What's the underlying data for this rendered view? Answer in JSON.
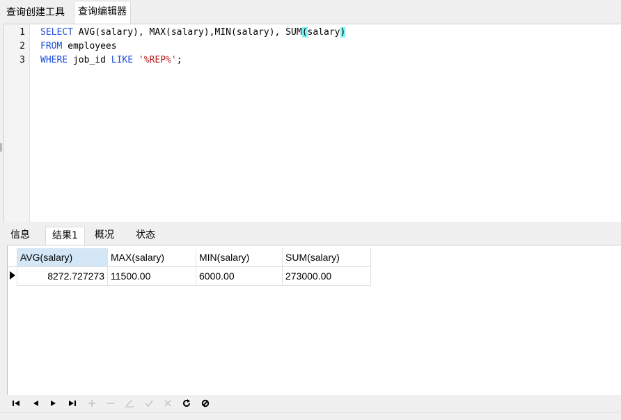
{
  "top_tabs": [
    {
      "label": "查询创建工具"
    },
    {
      "label": "查询编辑器"
    }
  ],
  "editor": {
    "line_numbers": [
      "1",
      "2",
      "3"
    ],
    "lines": [
      {
        "parts": [
          {
            "t": "SELECT",
            "k": "kw"
          },
          {
            "t": " AVG(salary), MAX(salary),MIN(salary), SUM"
          },
          {
            "t": "(",
            "k": "bracket"
          },
          {
            "t": "salary"
          },
          {
            "t": ")",
            "k": "bracket"
          }
        ]
      },
      {
        "parts": [
          {
            "t": "FROM",
            "k": "kw"
          },
          {
            "t": " employees"
          }
        ]
      },
      {
        "parts": [
          {
            "t": "WHERE",
            "k": "kw"
          },
          {
            "t": " job_id "
          },
          {
            "t": "LIKE",
            "k": "kw"
          },
          {
            "t": " "
          },
          {
            "t": "'%REP%'",
            "k": "str"
          },
          {
            "t": ";"
          }
        ]
      }
    ]
  },
  "bottom_tabs": [
    {
      "label": "信息"
    },
    {
      "label": "结果1"
    },
    {
      "label": "概况"
    },
    {
      "label": "状态"
    }
  ],
  "result_grid": {
    "columns": [
      "AVG(salary)",
      "MAX(salary)",
      "MIN(salary)",
      "SUM(salary)"
    ],
    "rows": [
      [
        "8272.727273",
        "11500.00",
        "6000.00",
        "273000.00"
      ]
    ]
  },
  "nav_icons": [
    "first-record-icon",
    "prev-record-icon",
    "next-record-icon",
    "last-record-icon",
    "add-record-icon",
    "delete-record-icon",
    "edit-record-icon",
    "apply-icon",
    "cancel-icon",
    "refresh-icon",
    "stop-icon"
  ],
  "colors": {
    "keyword": "#1d4ed8",
    "string": "#b91c1c",
    "bracket_highlight": "#7ff3f3",
    "selected_header": "#d3e7f6"
  }
}
